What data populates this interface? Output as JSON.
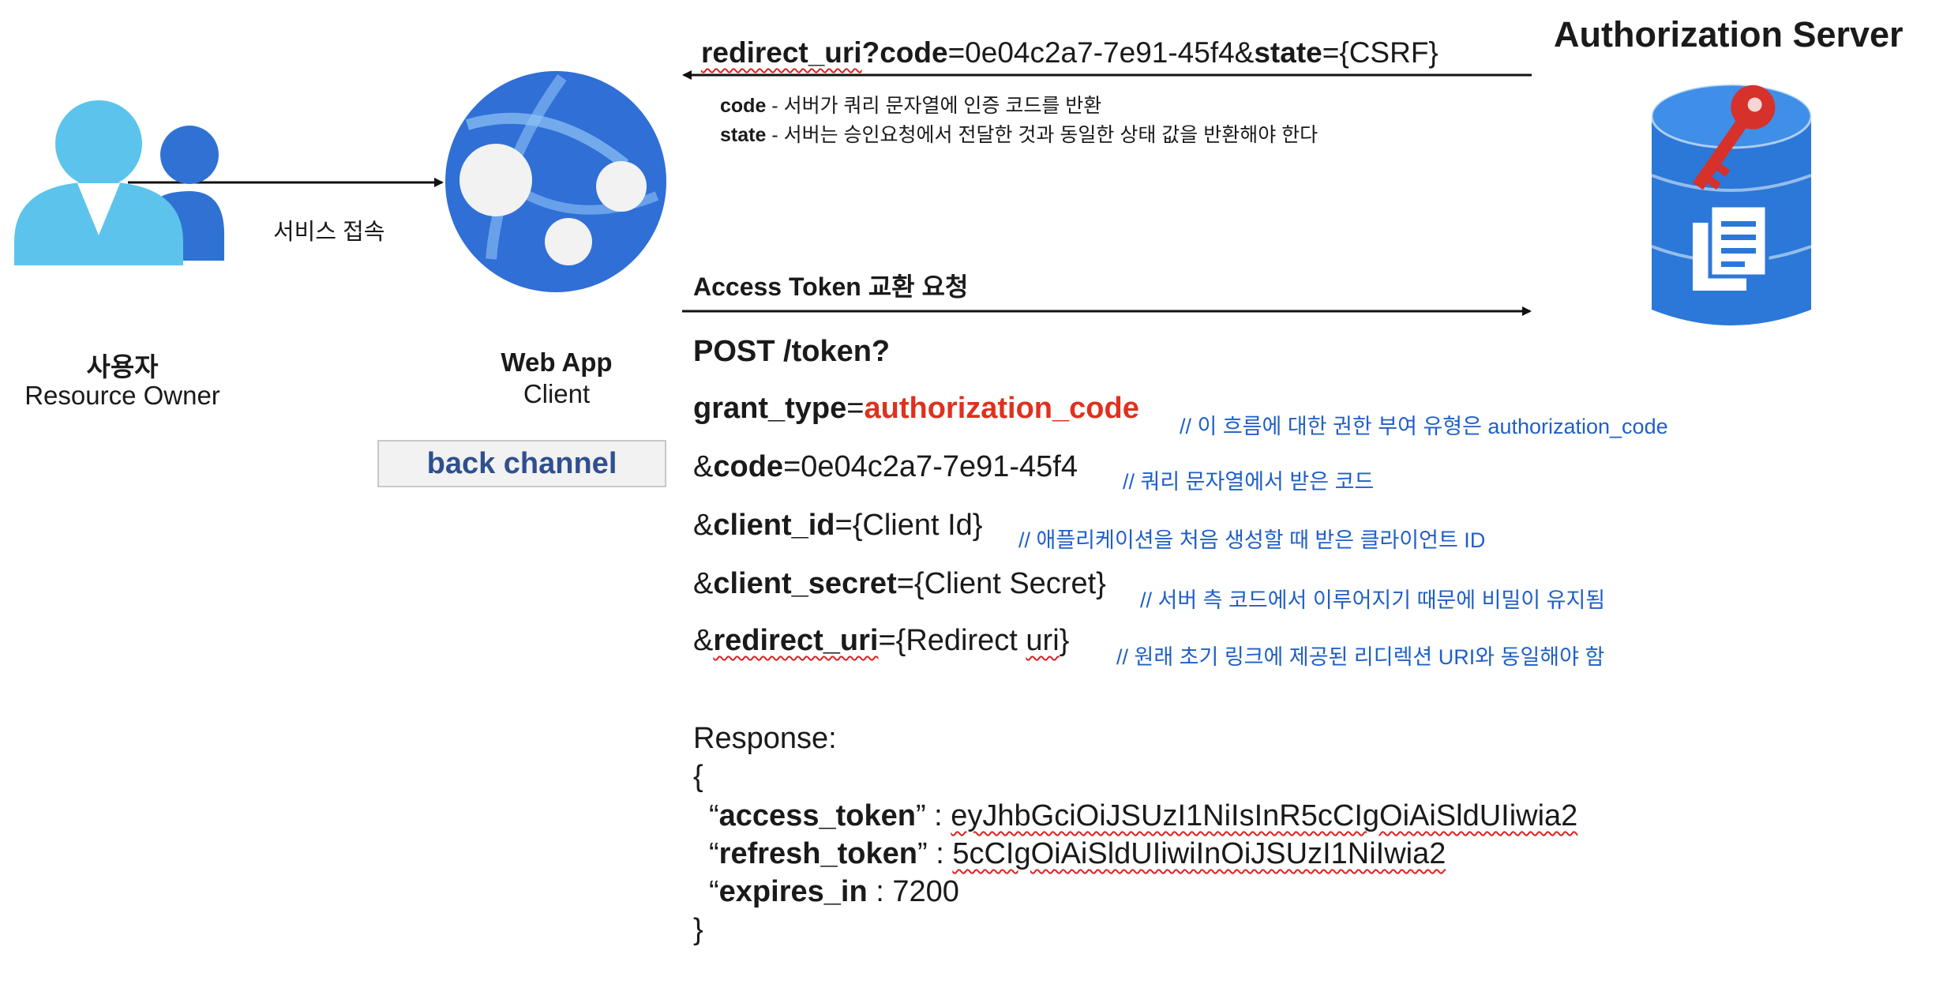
{
  "redirect": {
    "p1": "redirect_uri",
    "p2": "?code",
    "p3": "=0e04c2a7-7e91-45f4&",
    "p4": "state",
    "p5": "={CSRF}",
    "code_key": "code",
    "code_desc": " - 서버가 쿼리 문자열에 인증 코드를 반환",
    "state_key": "state",
    "state_desc": " - 서버는 승인요청에서 전달한 것과 동일한 상태 값을 반환해야 한다"
  },
  "auth_server": {
    "title": "Authorization Server"
  },
  "user": {
    "arrow_label": "서비스 접속",
    "title": "사용자",
    "subtitle": "Resource Owner"
  },
  "webapp": {
    "title": "Web App",
    "subtitle": "Client",
    "channel": "back channel"
  },
  "exchange": {
    "title": "Access Token 교환 요청"
  },
  "request": {
    "post": "POST /token?",
    "grant_key": "grant_type",
    "grant_eq": "=",
    "grant_val": "authorization_code",
    "grant_cmt": "// 이 흐름에 대한 권한 부여 유형은 authorization_code",
    "code_amp": "&",
    "code_key": "code",
    "code_val": "=0e04c2a7-7e91-45f4",
    "code_cmt": "// 쿼리 문자열에서 받은 코드",
    "cid_amp": "&",
    "cid_key": "client_id",
    "cid_val": "={Client Id}",
    "cid_cmt": "// 애플리케이션을 처음 생성할 때 받은 클라이언트 ID",
    "csec_amp": "&",
    "csec_key": "client_secret",
    "csec_val": "={Client Secret}",
    "csec_cmt": "// 서버 측 코드에서 이루어지기 때문에 비밀이 유지됨",
    "ruri_amp": "&",
    "ruri_key": "redirect_uri",
    "ruri_eq": "={Redirect ",
    "ruri_word": "uri",
    "ruri_close": "}",
    "ruri_cmt": "// 원래 초기 링크에 제공된 리디렉션 URI와 동일해야 함"
  },
  "response": {
    "label": "Response:",
    "open": "{",
    "at_q1": "“",
    "at_key": "access_token",
    "at_q2": "” : ",
    "at_val": "eyJhbGciOiJSUzI1NiIsInR5cCIgOiAiSldUIiwia2",
    "rt_q1": "“",
    "rt_key": "refresh_token",
    "rt_q2": "” : ",
    "rt_val": "5cCIgOiAiSldUIiwiInOiJSUzI1NiIwia2",
    "ex_q1": "“",
    "ex_key": "expires_in",
    "ex_rest": " : 7200",
    "close": "}"
  },
  "icons": {
    "user": "user-pair-icon",
    "webapp": "web-app-globe-icon",
    "server": "database-key-document-icon"
  },
  "colors": {
    "accent_red": "#e0301e",
    "comment_blue": "#1f5fc8",
    "channel_text": "#2f4f8f",
    "db_blue": "#2b78d8",
    "globe_blue": "#2f6fd6",
    "user_light": "#5cc4ec",
    "user_dark": "#2f72d4"
  }
}
